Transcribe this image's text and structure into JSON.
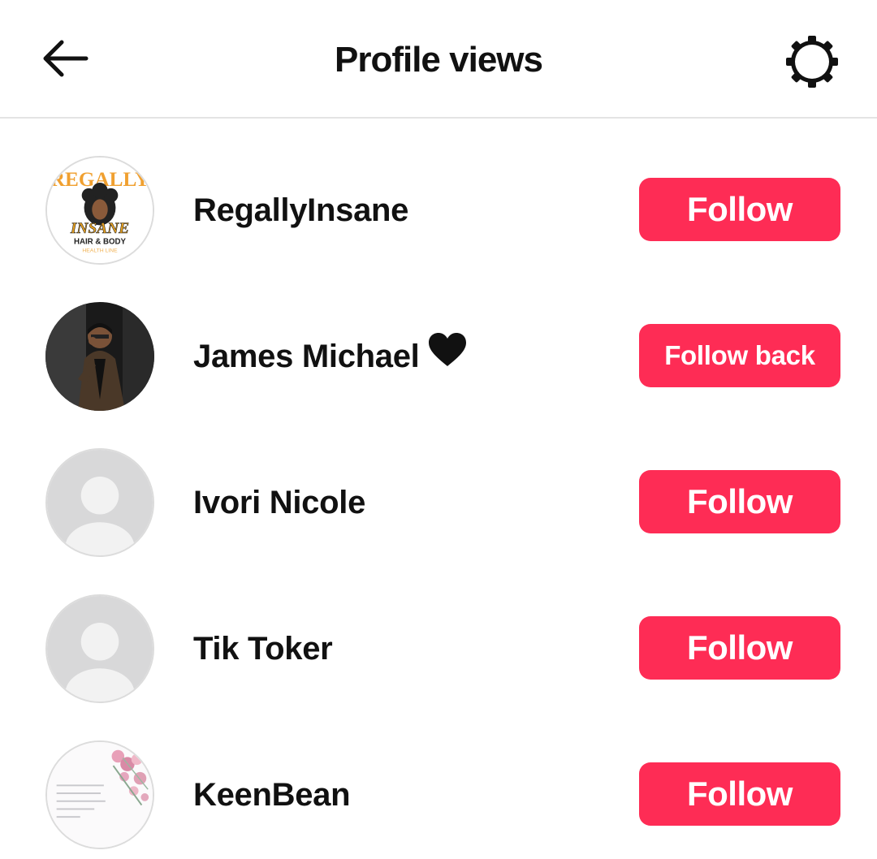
{
  "header": {
    "title": "Profile views",
    "back_icon": "arrow-left-icon",
    "settings_icon": "gear-icon"
  },
  "accent_color": "#fe2c55",
  "viewers": [
    {
      "name": "RegallyInsane",
      "button": "Follow",
      "avatar": "regallyinsane-logo",
      "logo_text": [
        "REGALLY",
        "INSANE",
        "HAIR & BODY",
        "HEALTH LINE"
      ]
    },
    {
      "name": "James Michael",
      "suffix_icon": "black-heart-icon",
      "button": "Follow back",
      "avatar": "photo"
    },
    {
      "name": "Ivori Nicole",
      "button": "Follow",
      "avatar": "default-avatar"
    },
    {
      "name": "Tik Toker",
      "button": "Follow",
      "avatar": "default-avatar"
    },
    {
      "name": "KeenBean",
      "button": "Follow",
      "avatar": "floral-image"
    }
  ]
}
